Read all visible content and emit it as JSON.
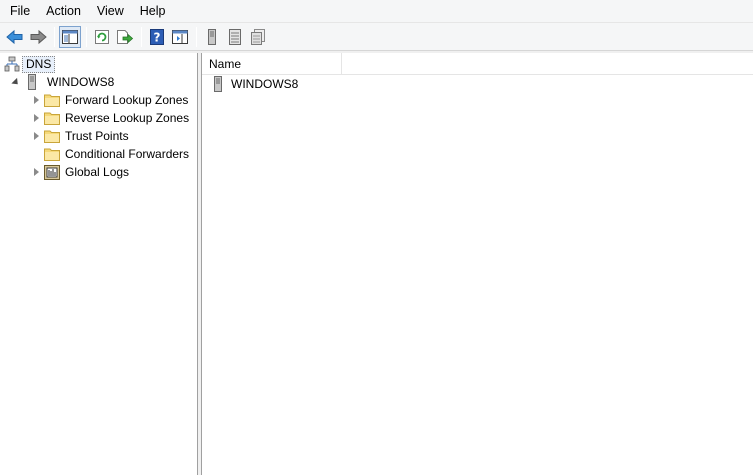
{
  "menu": {
    "items": [
      {
        "label": "File"
      },
      {
        "label": "Action"
      },
      {
        "label": "View"
      },
      {
        "label": "Help"
      }
    ]
  },
  "toolbar": {
    "buttons": [
      {
        "icon": "back-arrow-icon"
      },
      {
        "icon": "forward-arrow-icon"
      },
      {
        "icon": "show-hide-console-tree-icon"
      },
      {
        "icon": "refresh-icon"
      },
      {
        "icon": "export-list-icon"
      },
      {
        "icon": "help-icon"
      },
      {
        "icon": "show-hide-action-pane-icon"
      },
      {
        "icon": "server-icon"
      },
      {
        "icon": "list-icon"
      },
      {
        "icon": "copy-icon"
      }
    ]
  },
  "tree": {
    "root": {
      "label": "DNS",
      "icon": "dns-icon"
    },
    "server": {
      "label": "WINDOWS8",
      "icon": "server-icon"
    },
    "children": [
      {
        "label": "Forward Lookup Zones",
        "icon": "folder-icon",
        "expandable": true
      },
      {
        "label": "Reverse Lookup Zones",
        "icon": "folder-icon",
        "expandable": true
      },
      {
        "label": "Trust Points",
        "icon": "folder-icon",
        "expandable": true
      },
      {
        "label": "Conditional Forwarders",
        "icon": "folder-icon",
        "expandable": false
      },
      {
        "label": "Global Logs",
        "icon": "event-log-icon",
        "expandable": true
      }
    ]
  },
  "list": {
    "columns": [
      {
        "label": "Name"
      }
    ],
    "rows": [
      {
        "name": "WINDOWS8",
        "icon": "server-icon"
      }
    ]
  },
  "colors": {
    "folder": "#f5d97a",
    "arrow": "#3b8fd9",
    "selection": "#e8f0fb"
  }
}
